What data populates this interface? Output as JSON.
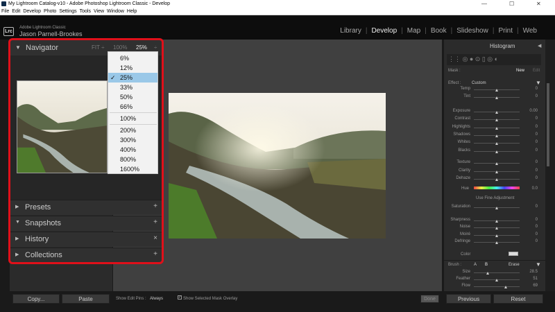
{
  "window": {
    "title": "My Lightroom Catalog-v10 - Adobe Photoshop Lightroom Classic - Develop",
    "minimize": "—",
    "maximize": "☐",
    "close": "✕"
  },
  "menu": [
    "File",
    "Edit",
    "Develop",
    "Photo",
    "Settings",
    "Tools",
    "View",
    "Window",
    "Help"
  ],
  "identity": {
    "logo": "Lrc",
    "line1": "Adobe Lightroom Classic",
    "line2": "Jason Parnell-Brookes"
  },
  "modules": [
    "Library",
    "Develop",
    "Map",
    "Book",
    "Slideshow",
    "Print",
    "Web"
  ],
  "active_module": "Develop",
  "navigator": {
    "title": "Navigator",
    "zoom_fit": "FIT ÷",
    "zoom_100": "100%",
    "zoom_current": "25%",
    "zoom_arrow": "÷",
    "options": [
      "6%",
      "12%",
      "25%",
      "33%",
      "50%",
      "66%",
      "100%",
      "200%",
      "300%",
      "400%",
      "800%",
      "1600%"
    ],
    "selected": "25%"
  },
  "sections": [
    {
      "label": "Presets",
      "action": "+"
    },
    {
      "label": "Snapshots",
      "action": "+"
    },
    {
      "label": "History",
      "action": "×"
    },
    {
      "label": "Collections",
      "action": "+"
    }
  ],
  "left_buttons": {
    "copy": "Copy...",
    "paste": "Paste"
  },
  "toolbar": {
    "show_edit_pins": "Show Edit Pins :",
    "edit_pins_value": "Always",
    "show_mask_overlay": "Show Selected Mask Overlay",
    "done": "Done"
  },
  "right_panel": {
    "histogram": "Histogram",
    "mask_label": "Mask :",
    "mask_new": "New",
    "mask_edit": "Edit",
    "effect_label": "Effect :",
    "effect_value": "Custom",
    "sliders": [
      {
        "label": "Temp",
        "value": "0"
      },
      {
        "label": "Tint",
        "value": "0"
      },
      {
        "label": "Exposure",
        "value": "0.00"
      },
      {
        "label": "Contrast",
        "value": "0"
      },
      {
        "label": "Highlights",
        "value": "0"
      },
      {
        "label": "Shadows",
        "value": "0"
      },
      {
        "label": "Whites",
        "value": "0"
      },
      {
        "label": "Blacks",
        "value": "0"
      },
      {
        "label": "Texture",
        "value": "0"
      },
      {
        "label": "Clarity",
        "value": "0"
      },
      {
        "label": "Dehaze",
        "value": "0"
      }
    ],
    "hue_label": "Hue",
    "hue_value": "0.0",
    "use_fine": "Use Fine Adjustment",
    "sliders2": [
      {
        "label": "Saturation",
        "value": "0"
      },
      {
        "label": "Sharpness",
        "value": "0"
      },
      {
        "label": "Noise",
        "value": "0"
      },
      {
        "label": "Moiré",
        "value": "0"
      },
      {
        "label": "Defringe",
        "value": "0"
      }
    ],
    "color_label": "Color",
    "brush_label": "Brush :",
    "brush_a": "A",
    "brush_b": "B",
    "brush_erase": "Erase",
    "brush_sliders": [
      {
        "label": "Size",
        "value": "28.5"
      },
      {
        "label": "Feather",
        "value": "51"
      },
      {
        "label": "Flow",
        "value": "69"
      }
    ],
    "previous": "Previous",
    "reset": "Reset"
  }
}
